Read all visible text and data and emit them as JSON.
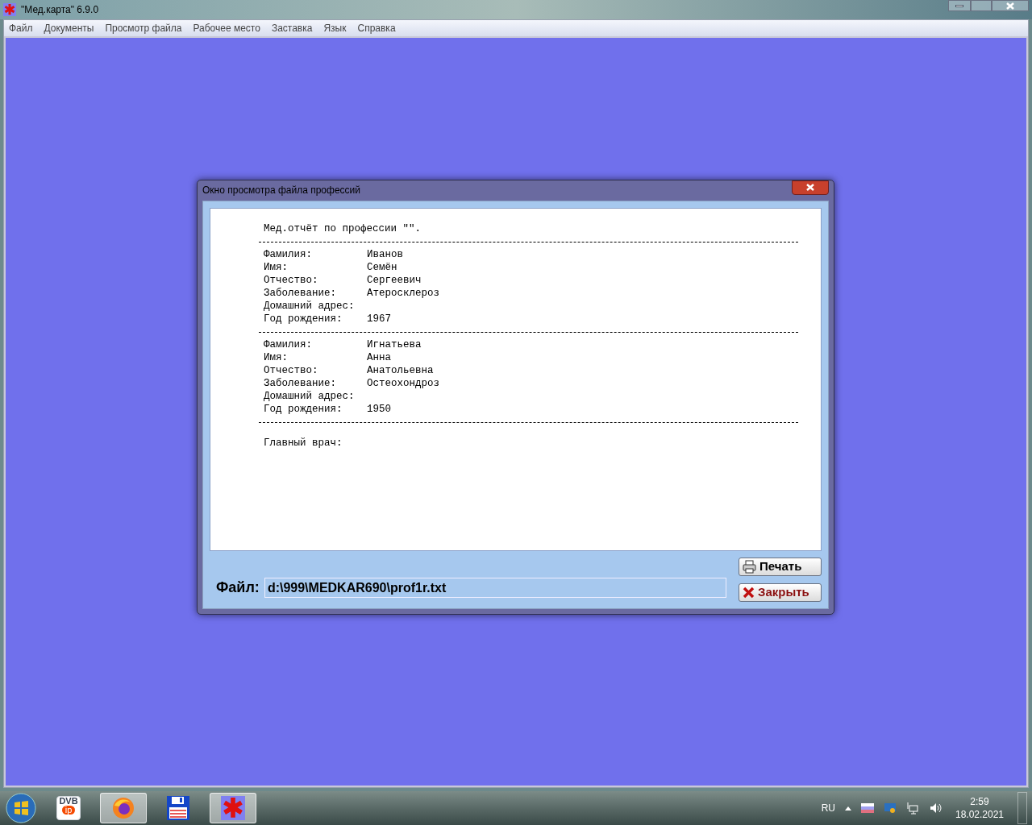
{
  "window": {
    "title": "\"Мед.карта\" 6.9.0"
  },
  "menu": [
    "Файл",
    "Документы",
    "Просмотр файла",
    "Рабочее место",
    "Заставка",
    "Язык",
    "Справка"
  ],
  "dialog": {
    "title": "Окно просмотра файла профессий",
    "report": {
      "heading": "Мед.отчёт по профессии \"\".",
      "records": [
        {
          "fields": [
            {
              "label": "Фамилия:",
              "value": "Иванов"
            },
            {
              "label": "Имя:",
              "value": "Семён"
            },
            {
              "label": "Отчество:",
              "value": "Сергеевич"
            },
            {
              "label": "Заболевание:",
              "value": "Атеросклероз"
            },
            {
              "label": "Домашний адрес:"
            },
            {
              "label": "Год рождения:",
              "value": "1967"
            }
          ]
        },
        {
          "fields": [
            {
              "label": "Фамилия:",
              "value": "Игнатьева"
            },
            {
              "label": "Имя:",
              "value": "Анна"
            },
            {
              "label": "Отчество:",
              "value": "Анатольевна"
            },
            {
              "label": "Заболевание:",
              "value": "Остеохондроз"
            },
            {
              "label": "Домашний адрес:"
            },
            {
              "label": "Год рождения:",
              "value": "1950"
            }
          ]
        }
      ],
      "footer": "Главный врач:"
    },
    "file_label": "Файл:",
    "file_value": "d:\\999\\MEDKAR690\\prof1r.txt",
    "buttons": [
      {
        "kind": "print",
        "label": "Печать"
      },
      {
        "kind": "close",
        "label": "Закрыть"
      }
    ]
  },
  "taskbar": {
    "apps": [
      {
        "kind": "dvb",
        "top": "DVB",
        "bottom": "ip",
        "selected": false
      },
      {
        "kind": "browser",
        "selected": true
      },
      {
        "kind": "disk",
        "selected": false
      },
      {
        "kind": "medcard",
        "selected": true
      }
    ],
    "language": "RU",
    "time": "2:59",
    "date": "18.02.2021"
  }
}
